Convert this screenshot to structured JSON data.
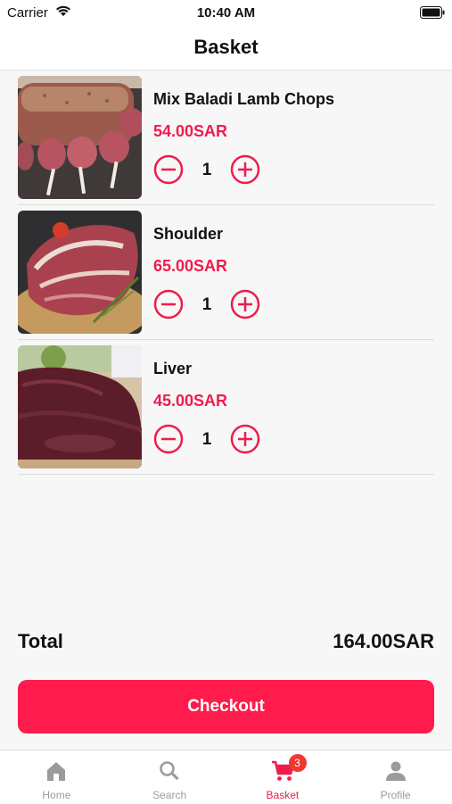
{
  "status_bar": {
    "carrier": "Carrier",
    "time": "10:40 AM"
  },
  "header": {
    "title": "Basket"
  },
  "items": [
    {
      "name": "Mix Baladi Lamb Chops",
      "price": "54.00SAR",
      "quantity": "1"
    },
    {
      "name": "Shoulder",
      "price": "65.00SAR",
      "quantity": "1"
    },
    {
      "name": "Liver",
      "price": "45.00SAR",
      "quantity": "1"
    }
  ],
  "summary": {
    "total_label": "Total",
    "total_value": "164.00SAR"
  },
  "checkout": {
    "label": "Checkout"
  },
  "tabs": [
    {
      "label": "Home",
      "icon": "home-icon"
    },
    {
      "label": "Search",
      "icon": "search-icon"
    },
    {
      "label": "Basket",
      "icon": "cart-icon",
      "badge": "3",
      "active": true
    },
    {
      "label": "Profile",
      "icon": "person-icon"
    }
  ],
  "colors": {
    "accent": "#ff1b4b",
    "price": "#f01c4c",
    "badge": "#f0382e"
  }
}
